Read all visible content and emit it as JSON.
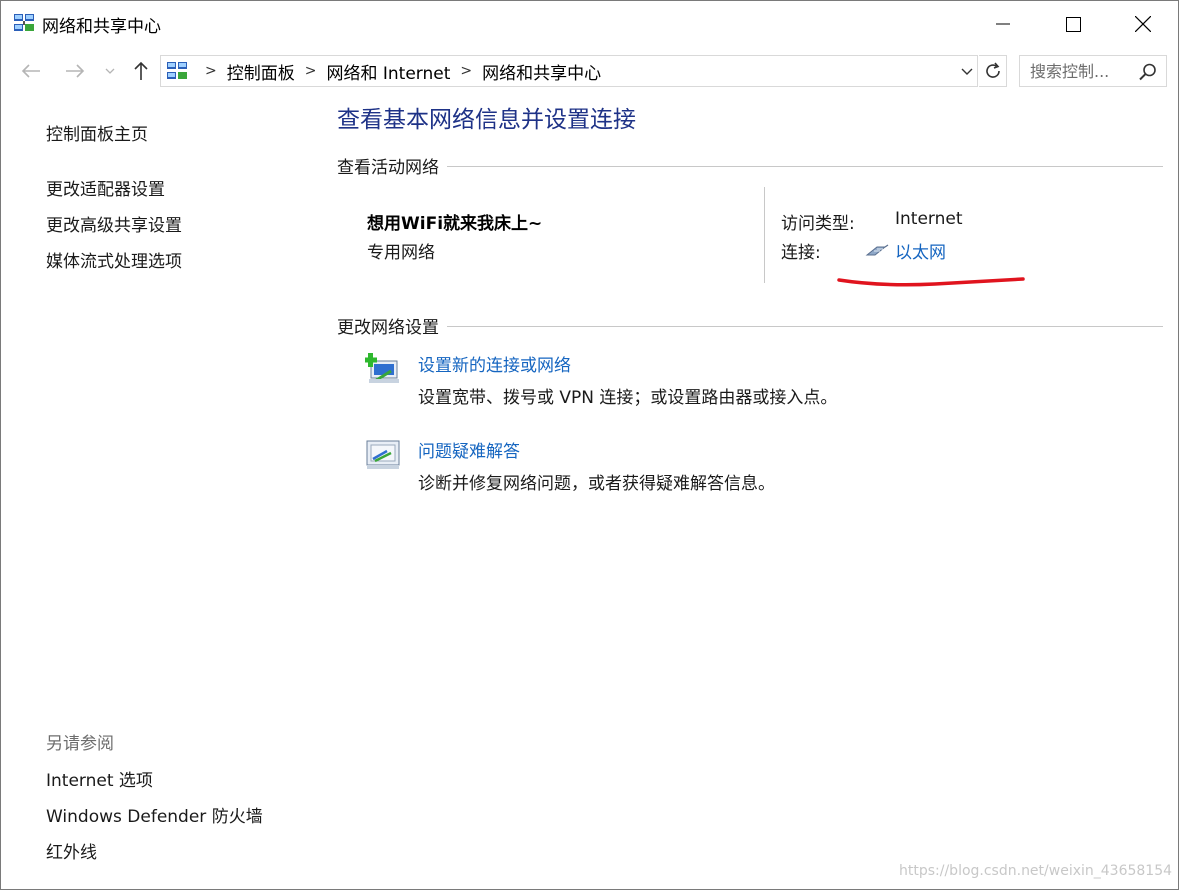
{
  "window": {
    "title": "网络和共享中心",
    "app_icon": "network-center-icon",
    "controls": [
      "minimize-icon",
      "maximize-icon",
      "close-icon"
    ]
  },
  "address_bar": {
    "breadcrumbs": [
      "控制面板",
      "网络和 Internet",
      "网络和共享中心"
    ],
    "search_placeholder": "搜索控制..."
  },
  "sidebar": {
    "home_link": "控制面板主页",
    "links": [
      "更改适配器设置",
      "更改高级共享设置",
      "媒体流式处理选项"
    ],
    "see_also_heading": "另请参阅",
    "see_also_links": [
      "Internet 选项",
      "Windows Defender 防火墙",
      "红外线"
    ]
  },
  "main": {
    "title": "查看基本网络信息并设置连接",
    "active_networks": {
      "heading": "查看活动网络",
      "network_name": "想用WiFi就来我床上~",
      "network_type": "专用网络",
      "access_type_label": "访问类型:",
      "access_type_value": "Internet",
      "connection_label": "连接:",
      "connection_value": "以太网"
    },
    "change_settings": {
      "heading": "更改网络设置",
      "tasks": [
        {
          "link": "设置新的连接或网络",
          "description": "设置宽带、拨号或 VPN 连接；或设置路由器或接入点。",
          "icon": "new-connection-icon"
        },
        {
          "link": "问题疑难解答",
          "description": "诊断并修复网络问题，或者获得疑难解答信息。",
          "icon": "troubleshoot-icon"
        }
      ]
    }
  },
  "watermark": "https://blog.csdn.net/weixin_43658154",
  "colors": {
    "title_blue": "#1e3287",
    "link_blue": "#1565c0",
    "annotation_red": "#e0141e"
  }
}
